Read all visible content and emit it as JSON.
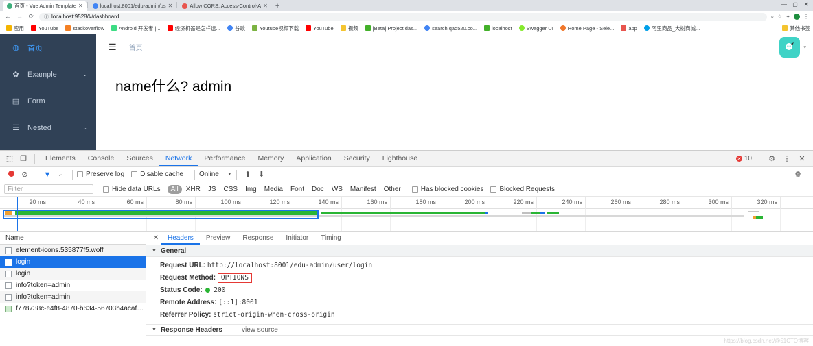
{
  "browser": {
    "tabs": [
      {
        "label": "首页 - Vue Admin Template",
        "active": true,
        "color": "#3eaf7c"
      },
      {
        "label": "localhost:8001/edu-admin/us",
        "active": false,
        "color": "#4285f4"
      },
      {
        "label": "Allow CORS: Access-Control-A",
        "active": false,
        "color": "#e8554e"
      }
    ],
    "new_tab_label": "+",
    "window_controls": [
      "—",
      "▢",
      "✕"
    ],
    "nav": {
      "back": "←",
      "forward": "→",
      "reload": "⟳"
    },
    "url": "localhost:9528/#/dashboard",
    "url_info_icon": "ⓘ",
    "omnibox_icons": [
      "zoom-icon",
      "star-icon",
      "extensions-icon",
      "profile-icon",
      "menu-icon"
    ],
    "bookmarks": [
      {
        "label": "应用",
        "color": "#f4b400"
      },
      {
        "label": "YouTube",
        "color": "#ff0000"
      },
      {
        "label": "stackoverflow",
        "color": "#f48024"
      },
      {
        "label": "Android 开发者 |...",
        "color": "#3ddc84"
      },
      {
        "label": "经济机器是怎样运...",
        "color": "#ff0000"
      },
      {
        "label": "谷歌",
        "color": "#4285f4"
      },
      {
        "label": "Youtube视频下载",
        "color": "#7cb342"
      },
      {
        "label": "YouTube",
        "color": "#ff0000"
      },
      {
        "label": "视频",
        "color": "#f4c430"
      },
      {
        "label": "[Beta] Project das...",
        "color": "#43b02a"
      },
      {
        "label": "search.qad520.co...",
        "color": "#4285f4"
      },
      {
        "label": "localhost",
        "color": "#43b02a"
      },
      {
        "label": "Swagger UI",
        "color": "#85ea2d"
      },
      {
        "label": "Home Page - Sele...",
        "color": "#f0772b"
      },
      {
        "label": "app",
        "color": "#e8554e"
      },
      {
        "label": "阿里商品_大树商城...",
        "color": "#00a0e9"
      }
    ],
    "bookmarks_overflow": {
      "label": "其他书签",
      "color": "#f4c430"
    }
  },
  "webapp": {
    "sidebar": [
      {
        "label": "首页",
        "icon": "dashboard-icon",
        "glyph": "◍",
        "active": true,
        "caret": ""
      },
      {
        "label": "Example",
        "icon": "example-icon",
        "glyph": "✿",
        "active": false,
        "caret": "⌄"
      },
      {
        "label": "Form",
        "icon": "form-icon",
        "glyph": "▤",
        "active": false,
        "caret": ""
      },
      {
        "label": "Nested",
        "icon": "nested-icon",
        "glyph": "☰",
        "active": false,
        "caret": "⌄"
      }
    ],
    "header": {
      "hamburger_icon": "hamburger-icon",
      "breadcrumb": "首页",
      "avatar_glyph": "☻",
      "avatar_color": "#3fd3c6",
      "caret": "▾"
    },
    "content_text": "name什么? admin"
  },
  "devtools": {
    "panel_tabs": [
      {
        "label": "Elements",
        "active": false
      },
      {
        "label": "Console",
        "active": false
      },
      {
        "label": "Sources",
        "active": false
      },
      {
        "label": "Network",
        "active": true
      },
      {
        "label": "Performance",
        "active": false
      },
      {
        "label": "Memory",
        "active": false
      },
      {
        "label": "Application",
        "active": false
      },
      {
        "label": "Security",
        "active": false
      },
      {
        "label": "Lighthouse",
        "active": false
      }
    ],
    "inspect_icon": "inspect-element-icon",
    "device_icon": "device-toolbar-icon",
    "error_count": "10",
    "settings_icon": "gear-icon",
    "more_icon": "kebab-menu-icon",
    "close_icon": "close-icon",
    "network_toolbar": {
      "record_icon": "record-stop-icon",
      "clear_icon": "clear-icon",
      "filter_icon": "filter-icon",
      "search_icon": "search-icon",
      "preserve_log": "Preserve log",
      "disable_cache": "Disable cache",
      "throttling": "Online",
      "throttle_caret": "▾",
      "import_icon": "import-har-icon",
      "export_icon": "export-har-icon"
    },
    "filter_row": {
      "filter_placeholder": "Filter",
      "hide_data_urls": "Hide data URLs",
      "types": [
        "All",
        "XHR",
        "JS",
        "CSS",
        "Img",
        "Media",
        "Font",
        "Doc",
        "WS",
        "Manifest",
        "Other"
      ],
      "selected_type": "All",
      "has_blocked_cookies": "Has blocked cookies",
      "blocked_requests": "Blocked Requests"
    },
    "timeline": {
      "ticks": [
        "20 ms",
        "40 ms",
        "60 ms",
        "80 ms",
        "100 ms",
        "120 ms",
        "140 ms",
        "160 ms",
        "180 ms",
        "200 ms",
        "220 ms",
        "240 ms",
        "260 ms",
        "280 ms",
        "300 ms",
        "320 ms"
      ]
    },
    "requests": {
      "column_header": "Name",
      "rows": [
        {
          "name": "element-icons.535877f5.woff",
          "selected": false,
          "icon": "file-icon"
        },
        {
          "name": "login",
          "selected": true,
          "icon": "file-icon"
        },
        {
          "name": "login",
          "selected": false,
          "icon": "file-icon"
        },
        {
          "name": "info?token=admin",
          "selected": false,
          "icon": "file-icon"
        },
        {
          "name": "info?token=admin",
          "selected": false,
          "icon": "file-icon"
        },
        {
          "name": "f778738c-e4f8-4870-b634-56703b4acafe....",
          "selected": false,
          "icon": "image-file-icon"
        }
      ]
    },
    "detail": {
      "close_icon": "close-detail-icon",
      "tabs": [
        {
          "label": "Headers",
          "active": true
        },
        {
          "label": "Preview",
          "active": false
        },
        {
          "label": "Response",
          "active": false
        },
        {
          "label": "Initiator",
          "active": false
        },
        {
          "label": "Timing",
          "active": false
        }
      ],
      "general_section": "General",
      "fields": [
        {
          "key": "Request URL:",
          "value": "http://localhost:8001/edu-admin/user/login",
          "highlight": false
        },
        {
          "key": "Request Method:",
          "value": "OPTIONS",
          "highlight": true
        },
        {
          "key": "Status Code:",
          "value": "200",
          "status_dot": true,
          "highlight": false
        },
        {
          "key": "Remote Address:",
          "value": "[::1]:8001",
          "highlight": false
        },
        {
          "key": "Referrer Policy:",
          "value": "strict-origin-when-cross-origin",
          "highlight": false
        }
      ],
      "response_section": "Response Headers",
      "view_source": "view source"
    }
  },
  "watermark": "https://blog.csdn.net/@51CTO博客"
}
